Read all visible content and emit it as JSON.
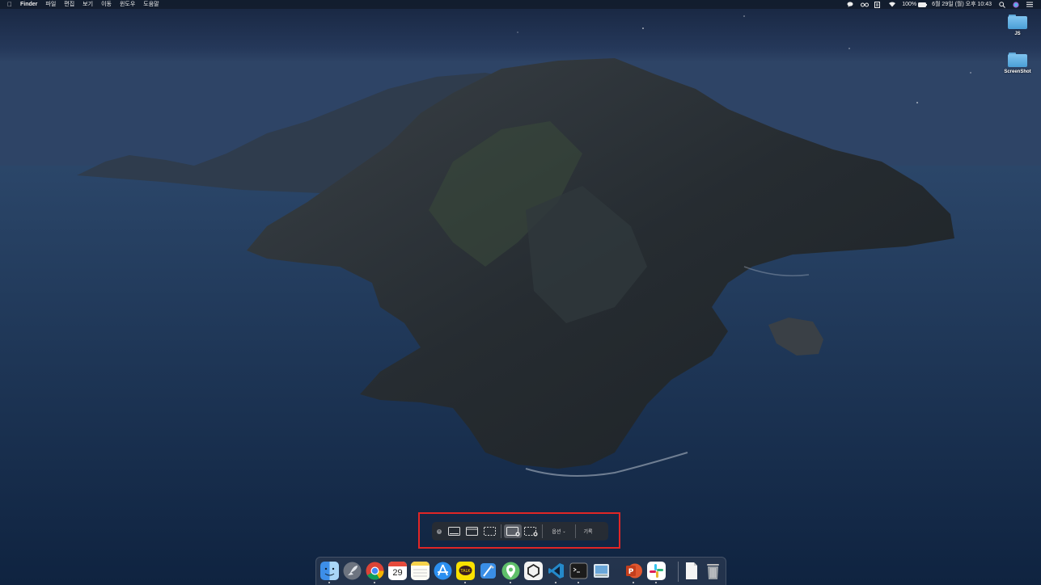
{
  "menubar": {
    "app_name": "Finder",
    "menus": [
      "파일",
      "편집",
      "보기",
      "이동",
      "윈도우",
      "도움말"
    ],
    "battery": "100%",
    "datetime": "6월 29일 (월) 오후 10:43"
  },
  "desktop": {
    "icons": [
      {
        "label": "JS",
        "icon": "folder-icon"
      },
      {
        "label": "ScreenShot",
        "icon": "folder-icon"
      }
    ]
  },
  "screenshot_toolbar": {
    "options_label": "옵션",
    "record_label": "기록",
    "selected_mode": "record-entire-screen"
  },
  "dock": {
    "apps": [
      "Finder",
      "Launchpad",
      "Chrome",
      "Calendar",
      "Notes",
      "App Store",
      "KakaoTalk",
      "Xcode",
      "Maps",
      "Unity",
      "Visual Studio Code",
      "Terminal",
      "Preview",
      "PowerPoint",
      "Slack",
      "Document",
      "Trash"
    ],
    "calendar_day": "29"
  },
  "colors": {
    "highlight_border": "#e02626",
    "folder_blue": "#5fa8d8"
  }
}
